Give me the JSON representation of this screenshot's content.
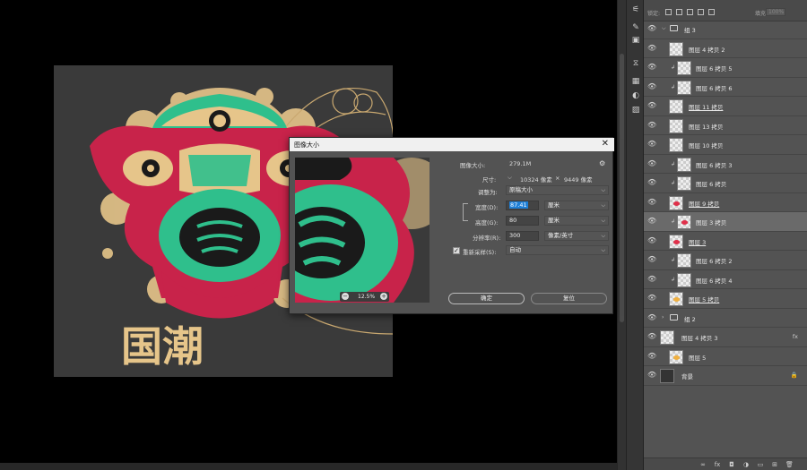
{
  "artwork": {
    "title_text": "国潮",
    "colors": {
      "bg": "#3a3a3a",
      "red": "#c8234a",
      "green": "#2fbf8c",
      "gold": "#e6c58a",
      "dark": "#1a1a1a"
    }
  },
  "dialog": {
    "title": "图像大小",
    "image_size_label": "图像大小:",
    "image_size_value": "279.1M",
    "dimensions_label": "尺寸:",
    "dim_width": "10324 像素",
    "dim_x": "×",
    "dim_height": "9449 像素",
    "fit_label": "调整为:",
    "fit_value": "原稿大小",
    "width_label": "宽度(D):",
    "width_value": "87.41",
    "width_unit": "厘米",
    "height_label": "高度(G):",
    "height_value": "80",
    "height_unit": "厘米",
    "res_label": "分辨率(R):",
    "res_value": "300",
    "res_unit": "像素/英寸",
    "resample_label": "重新采样(S):",
    "resample_value": "自动",
    "zoom_value": "12.5%",
    "ok": "确定",
    "cancel": "复位"
  },
  "layers": {
    "rows": [
      {
        "name": "组 3",
        "type": "group"
      },
      {
        "name": "图层 4 拷贝 2",
        "type": "layer",
        "thumb": "pattern"
      },
      {
        "name": "图层 6 拷贝 5",
        "type": "clip"
      },
      {
        "name": "图层 6 拷贝 6",
        "type": "clip"
      },
      {
        "name": "图层 11 拷贝",
        "type": "layer",
        "underline": true
      },
      {
        "name": "图层 13 拷贝",
        "type": "layer"
      },
      {
        "name": "图层 10 拷贝",
        "type": "layer"
      },
      {
        "name": "图层 6 拷贝 3",
        "type": "clip"
      },
      {
        "name": "图层 6 拷贝",
        "type": "clip"
      },
      {
        "name": "图层 9 拷贝",
        "type": "layer",
        "underline": true,
        "mark": "#e0304a"
      },
      {
        "name": "图层 3 拷贝",
        "type": "clip",
        "selected": true,
        "mark": "#e0304a"
      },
      {
        "name": "图层 3",
        "type": "layer",
        "underline": true,
        "mark": "#e0304a"
      },
      {
        "name": "图层 6 拷贝 2",
        "type": "clip"
      },
      {
        "name": "图层 6 拷贝 4",
        "type": "clip"
      },
      {
        "name": "图层 5 拷贝",
        "type": "layer",
        "underline": true,
        "mark": "#f0b040"
      },
      {
        "name": "组 2",
        "type": "group2"
      },
      {
        "name": "图层 4 拷贝 3",
        "type": "fxlayer",
        "badge": "fx"
      },
      {
        "name": "图层 5",
        "type": "layer",
        "mark": "#f0b040"
      },
      {
        "name": "背景",
        "type": "bg"
      }
    ],
    "lock_label": "锁定:",
    "fill_label": "填充:",
    "fill_value": "100%"
  }
}
